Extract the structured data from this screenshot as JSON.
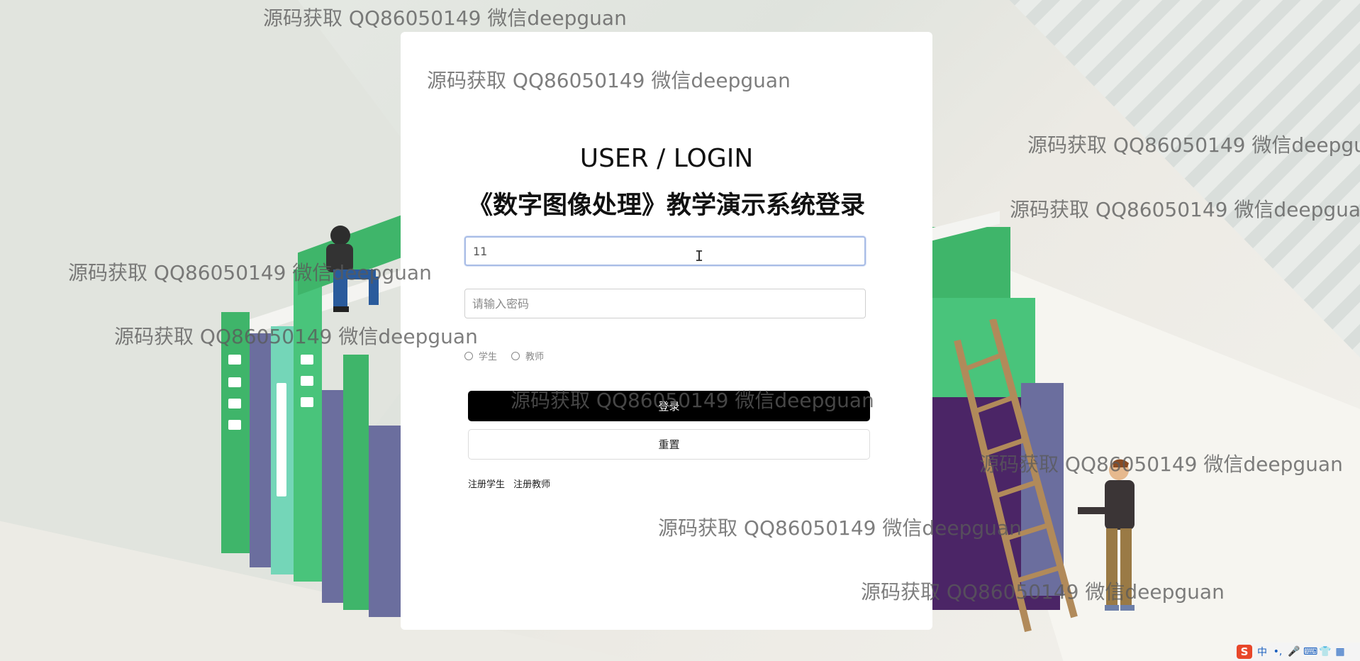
{
  "watermark": {
    "text": "源码获取 QQ86050149 微信deepguan"
  },
  "login": {
    "title_en": "USER / LOGIN",
    "title_cn": "《数字图像处理》教学演示系统登录",
    "username_value": "11",
    "password_placeholder": "请输入密码",
    "role_student": "学生",
    "role_teacher": "教师",
    "login_button": "登录",
    "reset_button": "重置",
    "register_student": "注册学生",
    "register_teacher": "注册教师"
  },
  "ime": {
    "logo": "S",
    "mode": "中",
    "punct": "•,",
    "mic": "🎤",
    "keyboard": "⌨",
    "skin": "👕",
    "tools": "▦"
  },
  "colors": {
    "book_green": "#3fb56a",
    "book_purple": "#6b6e9e",
    "book_dark_purple": "#4b2566",
    "login_button_bg": "#000000",
    "ime_logo": "#e8472a"
  }
}
